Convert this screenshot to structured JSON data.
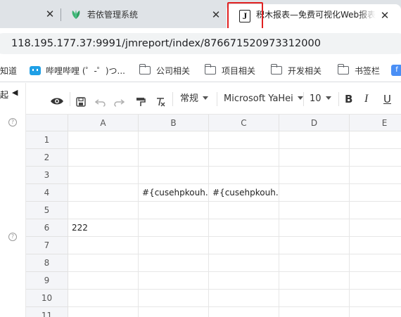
{
  "browser": {
    "tabs": [
      {
        "title": "若依管理系统",
        "active": false
      },
      {
        "title": "积木报表—免费可视化Web报表工具",
        "active": true
      }
    ],
    "close_glyph": "✕",
    "address": {
      "url": "118.195.177.37:9991/jmreport/index/876671520973312000"
    },
    "bookmarks": [
      {
        "label": "知道",
        "icon": "none"
      },
      {
        "label": "哔哩哔哩 (゜-゜)つ...",
        "icon": "bilibili-icon"
      },
      {
        "label": "公司相关",
        "icon": "folder-icon"
      },
      {
        "label": "项目相关",
        "icon": "folder-icon"
      },
      {
        "label": "开发相关",
        "icon": "folder-icon"
      },
      {
        "label": "书签栏",
        "icon": "folder-icon"
      }
    ],
    "highlight_color": "#e02020"
  },
  "app": {
    "gutter": {
      "label": "起",
      "help_glyph": "?"
    },
    "toolbar": {
      "format": "常规",
      "font": "Microsoft YaHei",
      "font_size": "10",
      "bold": "B",
      "italic": "I",
      "underline": "U"
    },
    "sheet": {
      "columns": [
        "A",
        "B",
        "C",
        "D",
        "E"
      ],
      "rows": [
        "1",
        "2",
        "3",
        "4",
        "5",
        "6",
        "7",
        "8",
        "9",
        "10",
        "11"
      ],
      "cells": {
        "B4": "#{cusehpkouh.",
        "C4": "#{cusehpkouh.",
        "A6": "222"
      }
    }
  }
}
